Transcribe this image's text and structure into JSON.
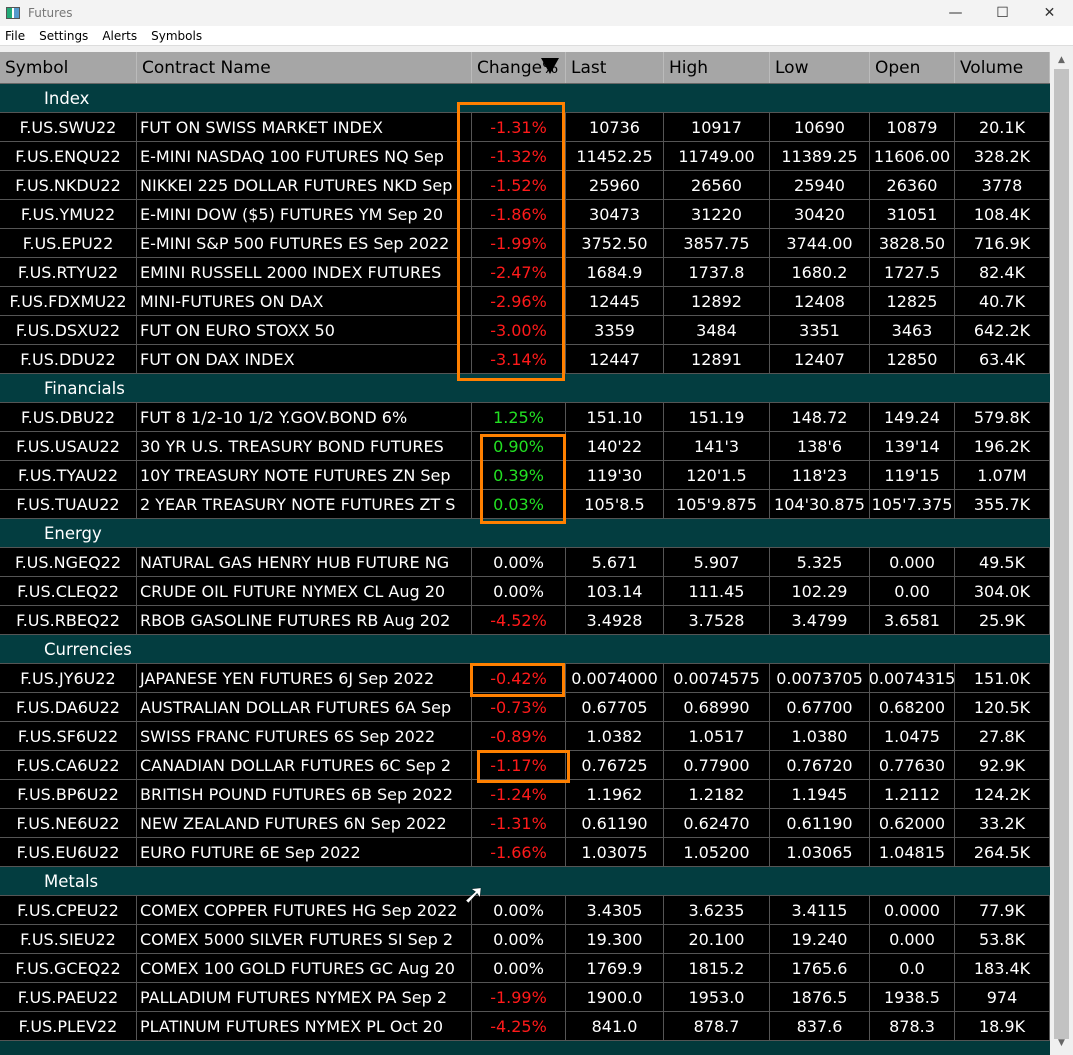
{
  "window": {
    "title": "Futures",
    "minimize": "—",
    "maximize": "☐",
    "close": "✕"
  },
  "menu": [
    "File",
    "Settings",
    "Alerts",
    "Symbols"
  ],
  "columns": [
    "Symbol",
    "Contract Name",
    "Change%",
    "Last",
    "High",
    "Low",
    "Open",
    "Volume"
  ],
  "sort": {
    "column": "Change%",
    "direction": "descending"
  },
  "colors": {
    "negative": "#ff1a1a",
    "positive": "#22e022",
    "group_bg": "#033d40",
    "highlight": "#ff8000"
  },
  "groups": [
    {
      "name": "Index",
      "rows": [
        [
          "F.US.SWU22",
          "FUT ON SWISS MARKET INDEX",
          "-1.31%",
          "10736",
          "10917",
          "10690",
          "10879",
          "20.1K"
        ],
        [
          "F.US.ENQU22",
          "E-MINI NASDAQ 100 FUTURES NQ Sep",
          "-1.32%",
          "11452.25",
          "11749.00",
          "11389.25",
          "11606.00",
          "328.2K"
        ],
        [
          "F.US.NKDU22",
          "NIKKEI 225 DOLLAR FUTURES NKD Sep",
          "-1.52%",
          "25960",
          "26560",
          "25940",
          "26360",
          "3778"
        ],
        [
          "F.US.YMU22",
          "E-MINI DOW ($5) FUTURES YM Sep 20",
          "-1.86%",
          "30473",
          "31220",
          "30420",
          "31051",
          "108.4K"
        ],
        [
          "F.US.EPU22",
          "E-MINI S&P 500 FUTURES ES Sep 2022",
          "-1.99%",
          "3752.50",
          "3857.75",
          "3744.00",
          "3828.50",
          "716.9K"
        ],
        [
          "F.US.RTYU22",
          "EMINI RUSSELL 2000 INDEX FUTURES",
          "-2.47%",
          "1684.9",
          "1737.8",
          "1680.2",
          "1727.5",
          "82.4K"
        ],
        [
          "F.US.FDXMU22",
          "MINI-FUTURES ON DAX",
          "-2.96%",
          "12445",
          "12892",
          "12408",
          "12825",
          "40.7K"
        ],
        [
          "F.US.DSXU22",
          "FUT ON EURO STOXX 50",
          "-3.00%",
          "3359",
          "3484",
          "3351",
          "3463",
          "642.2K"
        ],
        [
          "F.US.DDU22",
          "FUT ON DAX INDEX",
          "-3.14%",
          "12447",
          "12891",
          "12407",
          "12850",
          "63.4K"
        ]
      ]
    },
    {
      "name": "Financials",
      "rows": [
        [
          "F.US.DBU22",
          "FUT 8 1/2-10 1/2 Y.GOV.BOND 6%",
          "1.25%",
          "151.10",
          "151.19",
          "148.72",
          "149.24",
          "579.8K"
        ],
        [
          "F.US.USAU22",
          "30 YR U.S. TREASURY BOND FUTURES",
          "0.90%",
          "140'22",
          "141'3",
          "138'6",
          "139'14",
          "196.2K"
        ],
        [
          "F.US.TYAU22",
          "10Y TREASURY NOTE FUTURES ZN Sep",
          "0.39%",
          "119'30",
          "120'1.5",
          "118'23",
          "119'15",
          "1.07M"
        ],
        [
          "F.US.TUAU22",
          "2 YEAR TREASURY NOTE FUTURES ZT S",
          "0.03%",
          "105'8.5",
          "105'9.875",
          "104'30.875",
          "105'7.375",
          "355.7K"
        ]
      ]
    },
    {
      "name": "Energy",
      "rows": [
        [
          "F.US.NGEQ22",
          "NATURAL GAS HENRY HUB FUTURE NG",
          "0.00%",
          "5.671",
          "5.907",
          "5.325",
          "0.000",
          "49.5K"
        ],
        [
          "F.US.CLEQ22",
          "CRUDE OIL FUTURE NYMEX CL Aug 20",
          "0.00%",
          "103.14",
          "111.45",
          "102.29",
          "0.00",
          "304.0K"
        ],
        [
          "F.US.RBEQ22",
          "RBOB GASOLINE FUTURES RB Aug 202",
          "-4.52%",
          "3.4928",
          "3.7528",
          "3.4799",
          "3.6581",
          "25.9K"
        ]
      ]
    },
    {
      "name": "Currencies",
      "rows": [
        [
          "F.US.JY6U22",
          "JAPANESE YEN FUTURES 6J Sep 2022",
          "-0.42%",
          "0.0074000",
          "0.0074575",
          "0.0073705",
          "0.0074315",
          "151.0K"
        ],
        [
          "F.US.DA6U22",
          "AUSTRALIAN DOLLAR FUTURES 6A Sep",
          "-0.73%",
          "0.67705",
          "0.68990",
          "0.67700",
          "0.68200",
          "120.5K"
        ],
        [
          "F.US.SF6U22",
          "SWISS FRANC FUTURES 6S Sep 2022",
          "-0.89%",
          "1.0382",
          "1.0517",
          "1.0380",
          "1.0475",
          "27.8K"
        ],
        [
          "F.US.CA6U22",
          "CANADIAN DOLLAR FUTURES 6C Sep 2",
          "-1.17%",
          "0.76725",
          "0.77900",
          "0.76720",
          "0.77630",
          "92.9K"
        ],
        [
          "F.US.BP6U22",
          "BRITISH POUND FUTURES 6B Sep 2022",
          "-1.24%",
          "1.1962",
          "1.2182",
          "1.1945",
          "1.2112",
          "124.2K"
        ],
        [
          "F.US.NE6U22",
          "NEW ZEALAND FUTURES 6N Sep 2022",
          "-1.31%",
          "0.61190",
          "0.62470",
          "0.61190",
          "0.62000",
          "33.2K"
        ],
        [
          "F.US.EU6U22",
          "EURO FUTURE 6E Sep 2022",
          "-1.66%",
          "1.03075",
          "1.05200",
          "1.03065",
          "1.04815",
          "264.5K"
        ]
      ]
    },
    {
      "name": "Metals",
      "rows": [
        [
          "F.US.CPEU22",
          "COMEX COPPER FUTURES HG Sep 2022",
          "0.00%",
          "3.4305",
          "3.6235",
          "3.4115",
          "0.0000",
          "77.9K"
        ],
        [
          "F.US.SIEU22",
          "COMEX 5000 SILVER FUTURES SI Sep 2",
          "0.00%",
          "19.300",
          "20.100",
          "19.240",
          "0.000",
          "53.8K"
        ],
        [
          "F.US.GCEQ22",
          "COMEX 100 GOLD FUTURES GC Aug 20",
          "0.00%",
          "1769.9",
          "1815.2",
          "1765.6",
          "0.0",
          "183.4K"
        ],
        [
          "F.US.PAEU22",
          "PALLADIUM FUTURES NYMEX PA Sep 2",
          "-1.99%",
          "1900.0",
          "1953.0",
          "1876.5",
          "1938.5",
          "974"
        ],
        [
          "F.US.PLEV22",
          "PLATINUM FUTURES NYMEX PL Oct 20",
          "-4.25%",
          "841.0",
          "878.7",
          "837.6",
          "878.3",
          "18.9K"
        ]
      ]
    }
  ]
}
